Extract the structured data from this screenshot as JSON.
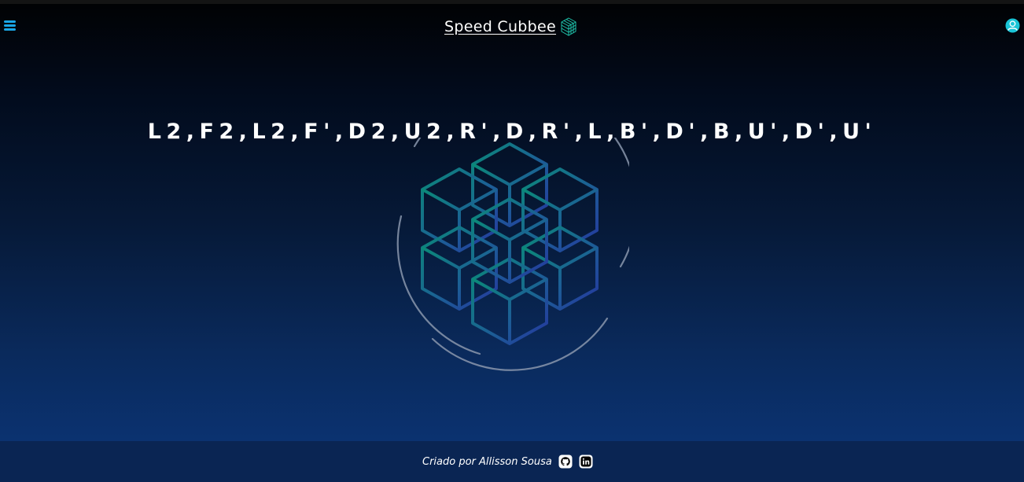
{
  "header": {
    "brand": "Speed Cubbee",
    "menu_icon": "hamburger-menu-icon",
    "brand_icon": "cube-logo-icon",
    "profile_icon": "user-profile-icon"
  },
  "main": {
    "scramble": "L2,F2,L2,F',D2,U2,R',D,R',L,B',D',B,U',D',U'"
  },
  "footer": {
    "credit": "Criado por Allisson Sousa",
    "github_icon": "github-icon",
    "linkedin_icon": "linkedin-icon"
  },
  "colors": {
    "accent": "#1aa6e6",
    "cube_top": "#0a8a78",
    "cube_bottom": "#253aa0",
    "footer_bg": "#0a2553"
  }
}
